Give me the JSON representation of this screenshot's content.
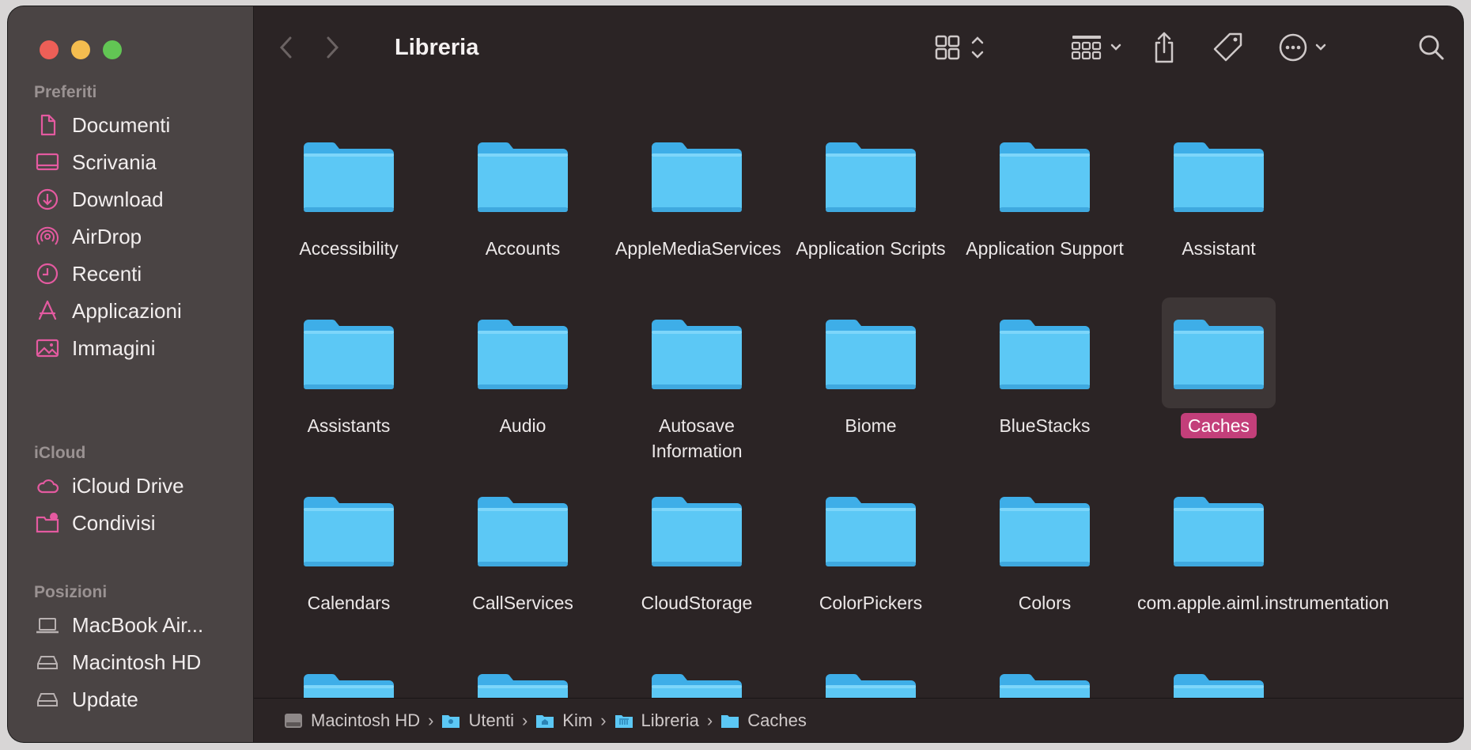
{
  "window": {
    "title": "Libreria"
  },
  "sidebar": {
    "sections": [
      {
        "title": "Preferiti"
      },
      {
        "title": "iCloud"
      },
      {
        "title": "Posizioni"
      }
    ],
    "favorites": [
      {
        "label": "Documenti",
        "icon": "document-icon"
      },
      {
        "label": "Scrivania",
        "icon": "desktop-icon"
      },
      {
        "label": "Download",
        "icon": "download-icon"
      },
      {
        "label": "AirDrop",
        "icon": "airdrop-icon"
      },
      {
        "label": "Recenti",
        "icon": "clock-icon"
      },
      {
        "label": "Applicazioni",
        "icon": "applications-icon"
      },
      {
        "label": "Immagini",
        "icon": "photo-icon"
      }
    ],
    "icloud": [
      {
        "label": "iCloud Drive",
        "icon": "cloud-icon"
      },
      {
        "label": "Condivisi",
        "icon": "shared-folder-icon"
      }
    ],
    "locations": [
      {
        "label": "MacBook Air...",
        "icon": "laptop-icon"
      },
      {
        "label": "Macintosh HD",
        "icon": "disk-icon"
      },
      {
        "label": "Update",
        "icon": "disk-icon"
      }
    ]
  },
  "folders": [
    "Accessibility",
    "Accounts",
    "AppleMediaServices",
    "Application Scripts",
    "Application Support",
    "Assistant",
    "Assistants",
    "Audio",
    "Autosave Information",
    "Biome",
    "BlueStacks",
    "Caches",
    "Calendars",
    "CallServices",
    "CloudStorage",
    "ColorPickers",
    "Colors",
    "com.apple.aiml.instrumentation",
    "",
    "",
    "",
    "",
    "",
    ""
  ],
  "selected_folder": "Caches",
  "pathbar": {
    "crumbs": [
      "Macintosh HD",
      "Utenti",
      "Kim",
      "Libreria",
      "Caches"
    ]
  },
  "colors": {
    "accent_selection": "#c33f7a",
    "folder": "#5cc8f5",
    "sidebar_icon": "#e45aa0"
  }
}
